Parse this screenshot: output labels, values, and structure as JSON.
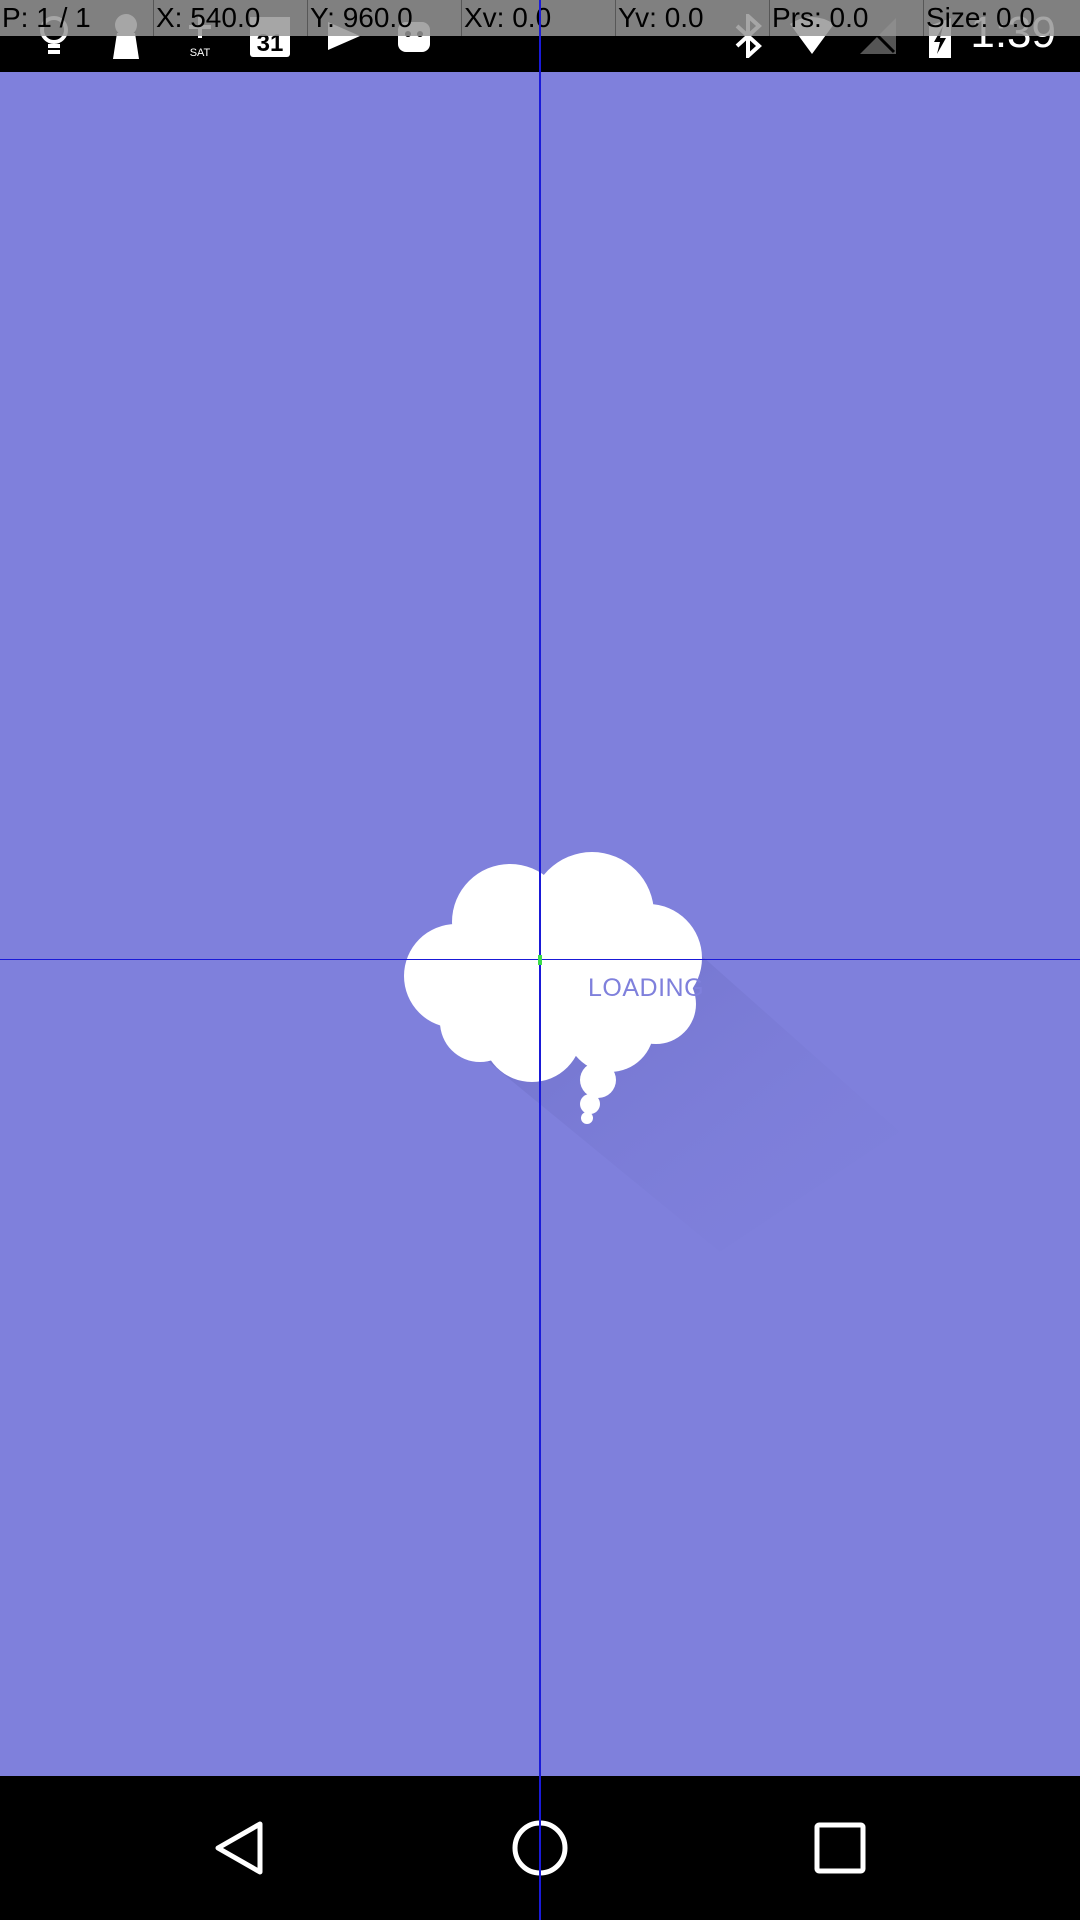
{
  "pointer_overlay": {
    "pointer": "P: 1 / 1",
    "x": "X: 540.0",
    "y": "Y: 960.0",
    "xv": "Xv: 0.0",
    "yv": "Yv: 0.0",
    "prs": "Prs: 0.0",
    "size": "Size: 0.0"
  },
  "status_bar": {
    "time": "1:39",
    "left_icons": [
      "lightbulb-icon",
      "keyhole-icon",
      "gps-sat-icon",
      "calendar-icon",
      "play-store-icon",
      "android-icon"
    ],
    "calendar_day": "31",
    "sat_label": "SAT",
    "right_icons": [
      "bluetooth-icon",
      "wifi-icon",
      "no-signal-icon",
      "battery-charging-icon"
    ]
  },
  "screen": {
    "background_color": "#7f80dc",
    "loading_text": "LOADING"
  },
  "nav_bar": {
    "buttons": [
      "back-icon",
      "home-icon",
      "recents-icon"
    ]
  }
}
